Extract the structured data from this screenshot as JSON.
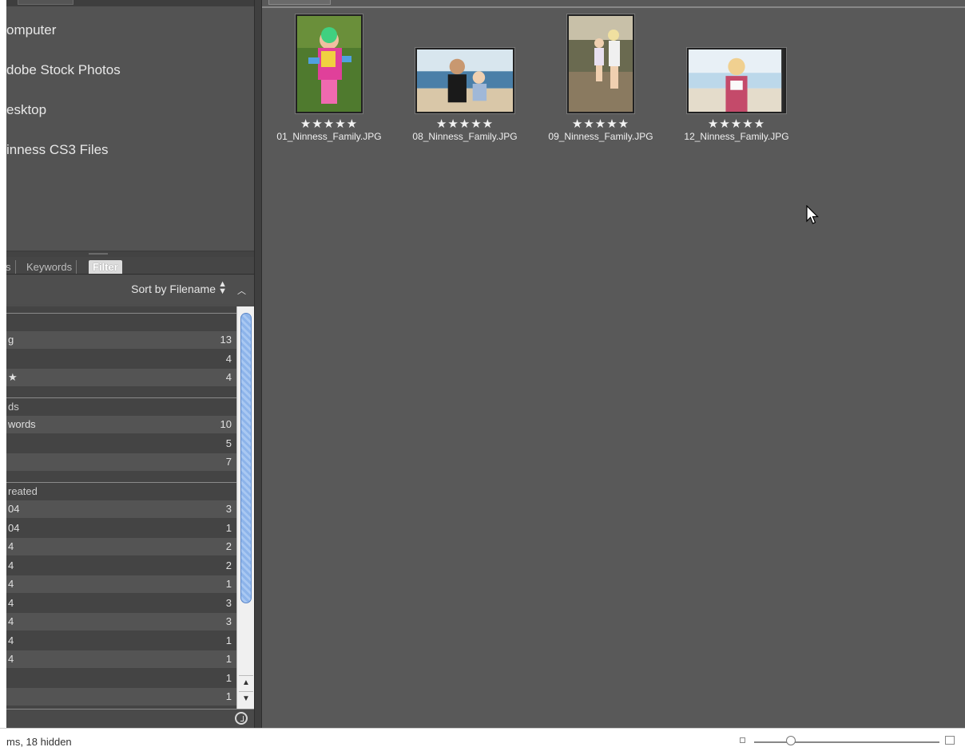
{
  "favorites": {
    "items": [
      {
        "label": "omputer"
      },
      {
        "label": "dobe Stock Photos"
      },
      {
        "label": "esktop"
      },
      {
        "label": "inness CS3 Files"
      }
    ]
  },
  "filter_panel": {
    "tabs": [
      {
        "label": "s",
        "active": false
      },
      {
        "label": "Keywords",
        "active": false
      },
      {
        "label": "Filter",
        "active": true
      }
    ],
    "sort_label": "Sort by Filename",
    "sections": [
      {
        "header": "",
        "rows": [
          {
            "label": "g",
            "count": "13"
          },
          {
            "label": "",
            "count": "4"
          },
          {
            "label": "★",
            "count": "4"
          }
        ]
      },
      {
        "header": "ds",
        "rows": [
          {
            "label": "words",
            "count": "10"
          },
          {
            "label": "",
            "count": "5"
          },
          {
            "label": "",
            "count": "7"
          }
        ]
      },
      {
        "header": "reated",
        "rows": [
          {
            "label": "04",
            "count": "3"
          },
          {
            "label": "04",
            "count": "1"
          },
          {
            "label": "4",
            "count": "2"
          },
          {
            "label": "4",
            "count": "2"
          },
          {
            "label": "4",
            "count": "1"
          },
          {
            "label": "4",
            "count": "3"
          },
          {
            "label": "4",
            "count": "3"
          },
          {
            "label": "4",
            "count": "1"
          },
          {
            "label": "4",
            "count": "1"
          },
          {
            "label": "",
            "count": "1"
          },
          {
            "label": "",
            "count": "1"
          }
        ]
      }
    ]
  },
  "thumbnails": [
    {
      "filename": "01_Ninness_Family.JPG",
      "rating": "★★★★★",
      "orientation": "portrait",
      "scene": "child-in-pink-jacket-on-grass"
    },
    {
      "filename": "08_Ninness_Family.JPG",
      "rating": "★★★★★",
      "orientation": "landscape",
      "scene": "woman-with-baby-at-beach"
    },
    {
      "filename": "09_Ninness_Family.JPG",
      "rating": "★★★★★",
      "orientation": "portrait",
      "scene": "two-children-at-shore"
    },
    {
      "filename": "12_Ninness_Family.JPG",
      "rating": "★★★★★",
      "orientation": "landscape",
      "scene": "girl-at-beach"
    }
  ],
  "status": {
    "text": "ms, 18 hidden",
    "zoom_level": 0.2
  },
  "colors": {
    "panel_bg": "#4d4d4d",
    "content_bg": "#595959",
    "scroll_thumb": "#8db4ea"
  }
}
